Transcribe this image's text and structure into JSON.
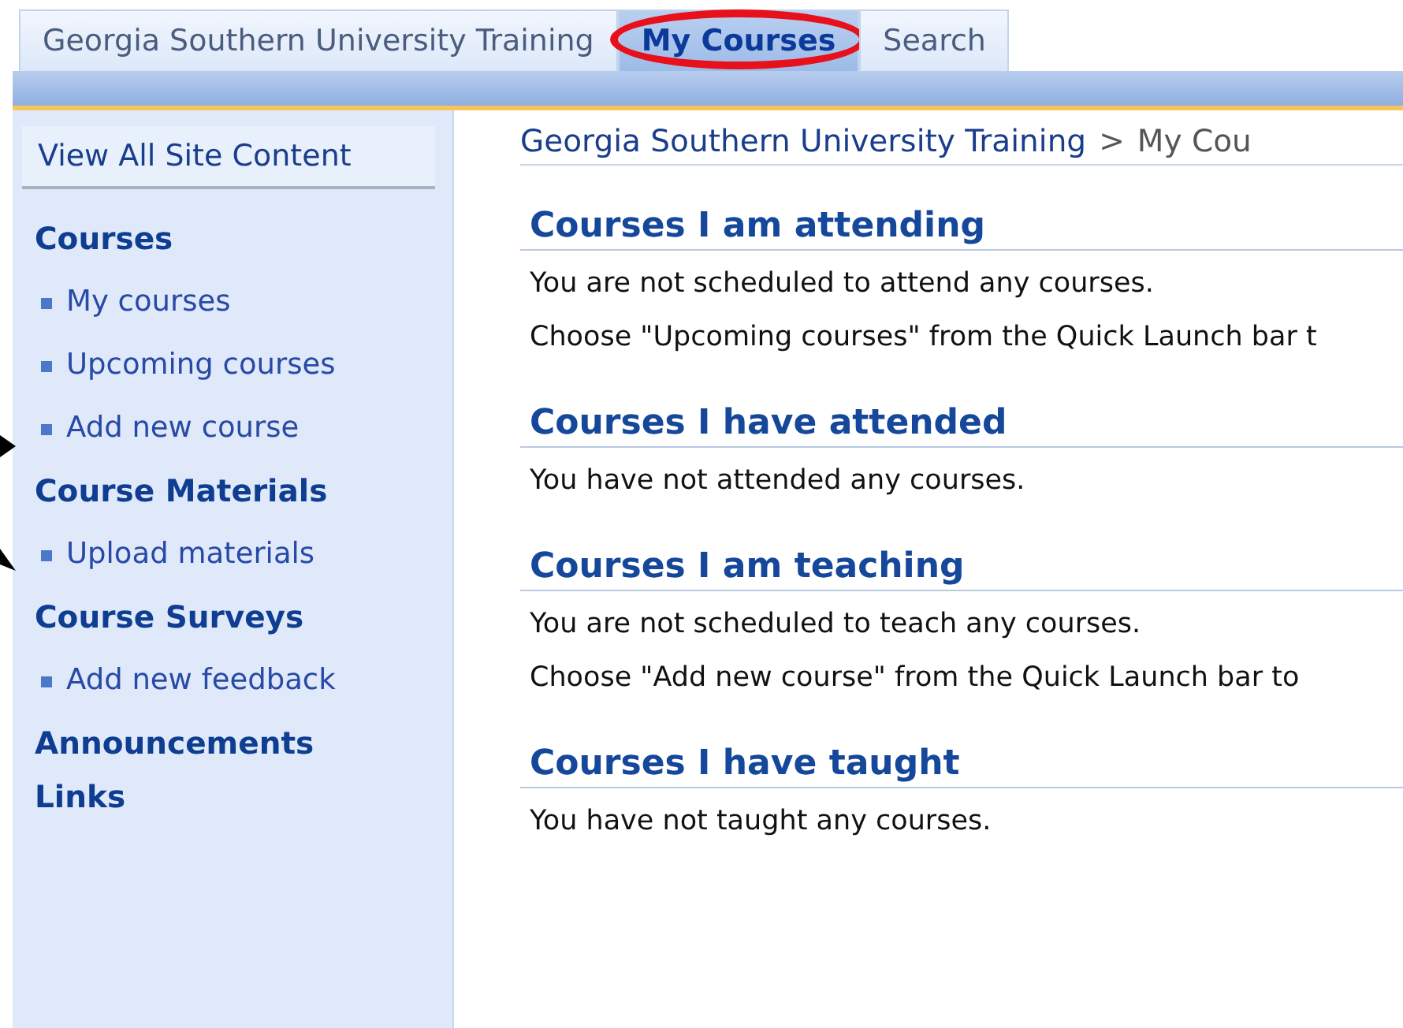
{
  "tabs": [
    {
      "label": "Georgia Southern University Training",
      "selected": false,
      "circled": false
    },
    {
      "label": "My Courses",
      "selected": true,
      "circled": true
    },
    {
      "label": "Search",
      "selected": false,
      "circled": false
    }
  ],
  "sidebar": {
    "view_all": "View All Site Content",
    "groups": [
      {
        "heading": "Courses",
        "items": [
          "My courses",
          "Upcoming courses",
          "Add new course"
        ]
      },
      {
        "heading": "Course Materials",
        "items": [
          "Upload materials"
        ]
      },
      {
        "heading": "Course Surveys",
        "items": [
          "Add new feedback"
        ]
      },
      {
        "heading": "Announcements"
      },
      {
        "heading": "Links"
      }
    ]
  },
  "breadcrumb": {
    "site": "Georgia Southern University Training",
    "separator": ">",
    "page": "My Cou"
  },
  "sections": [
    {
      "title": "Courses I am attending",
      "lines": [
        "You are not scheduled to attend any courses.",
        "Choose \"Upcoming courses\" from the Quick Launch bar t"
      ]
    },
    {
      "title": "Courses I have attended",
      "lines": [
        "You have not attended any courses."
      ]
    },
    {
      "title": "Courses I am teaching",
      "lines": [
        "You are not scheduled to teach any courses.",
        "Choose \"Add new course\" from the Quick Launch bar to"
      ]
    },
    {
      "title": "Courses I have taught",
      "lines": [
        "You have not taught any courses."
      ]
    }
  ]
}
